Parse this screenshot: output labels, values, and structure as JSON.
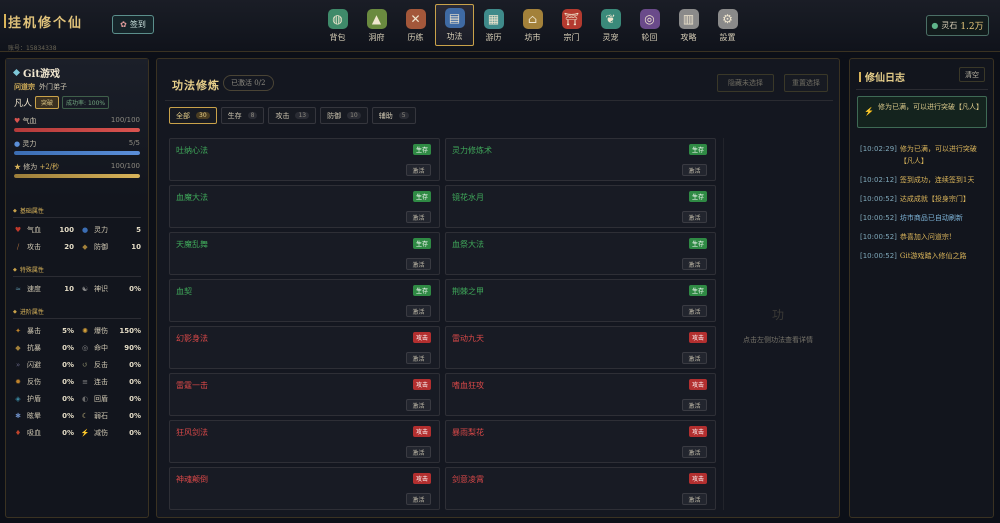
{
  "header": {
    "title": "挂机修个仙",
    "account_label": "账号：15834338",
    "checkin": "签到",
    "nav": [
      {
        "label": "背包",
        "icon": "bag-icon",
        "color": "#3f8a6a"
      },
      {
        "label": "洞府",
        "icon": "cave-icon",
        "color": "#6a8a3f"
      },
      {
        "label": "历练",
        "icon": "swords-icon",
        "color": "#a3573a"
      },
      {
        "label": "功法",
        "icon": "book-icon",
        "color": "#3f6aa3"
      },
      {
        "label": "游历",
        "icon": "map-icon",
        "color": "#3f8a8a"
      },
      {
        "label": "坊市",
        "icon": "market-icon",
        "color": "#a3813a"
      },
      {
        "label": "宗门",
        "icon": "gate-icon",
        "color": "#b33a2f"
      },
      {
        "label": "灵宠",
        "icon": "pet-icon",
        "color": "#3a8a7a"
      },
      {
        "label": "轮回",
        "icon": "cycle-icon",
        "color": "#6a4a8a"
      },
      {
        "label": "攻略",
        "icon": "guide-icon",
        "color": "#8a8a8a"
      },
      {
        "label": "設置",
        "icon": "gear-icon",
        "color": "#8a8a8a"
      }
    ],
    "currency_label": "灵石",
    "currency_value": "1.2万"
  },
  "character": {
    "name": "Git游戏",
    "sect": "问道宗",
    "rank": "外门弟子",
    "realm": "凡人",
    "breakthrough": "突破",
    "success_rate": "成功率: 100%",
    "bars": [
      {
        "label": "气血",
        "value": "100/100",
        "fill": 1.0,
        "kind": "hp"
      },
      {
        "label": "灵力",
        "value": "5/5",
        "fill": 1.0,
        "kind": "mp"
      },
      {
        "label": "修为",
        "rate": "+2/秒",
        "value": "100/100",
        "fill": 1.0,
        "kind": "xp"
      }
    ],
    "sections": [
      {
        "title": "基础属性",
        "attrs": [
          {
            "name": "气血",
            "value": "100",
            "icon": "heart-icon",
            "color": "#c0392b"
          },
          {
            "name": "灵力",
            "value": "5",
            "icon": "orb-icon",
            "color": "#3b6db3"
          },
          {
            "name": "攻击",
            "value": "20",
            "icon": "sword-icon",
            "color": "#a36a3a"
          },
          {
            "name": "防御",
            "value": "10",
            "icon": "shield-icon",
            "color": "#a3813a"
          }
        ]
      },
      {
        "title": "特殊属性",
        "attrs": [
          {
            "name": "速度",
            "value": "10",
            "icon": "wind-icon",
            "color": "#5b8fa3"
          },
          {
            "name": "神识",
            "value": "0%",
            "icon": "yinyang-icon",
            "color": "#8a8a8a"
          }
        ]
      },
      {
        "title": "进阶属性",
        "attrs": [
          {
            "name": "暴击",
            "value": "5%",
            "icon": "crit-icon",
            "color": "#c0832b"
          },
          {
            "name": "爆伤",
            "value": "150%",
            "icon": "burst-icon",
            "color": "#d9a33a"
          },
          {
            "name": "抗暴",
            "value": "0%",
            "icon": "shield-icon",
            "color": "#a3813a"
          },
          {
            "name": "命中",
            "value": "90%",
            "icon": "target-icon",
            "color": "#8a8a8a"
          },
          {
            "name": "闪避",
            "value": "0%",
            "icon": "dodge-icon",
            "color": "#6a6a8a"
          },
          {
            "name": "反击",
            "value": "0%",
            "icon": "counter-icon",
            "color": "#8a8a6a"
          },
          {
            "name": "反伤",
            "value": "0%",
            "icon": "reflect-icon",
            "color": "#c0832b"
          },
          {
            "name": "连击",
            "value": "0%",
            "icon": "combo-icon",
            "color": "#8a8a8a"
          },
          {
            "name": "护盾",
            "value": "0%",
            "icon": "barrier-icon",
            "color": "#3b8aa3"
          },
          {
            "name": "回盾",
            "value": "0%",
            "icon": "regen-icon",
            "color": "#6a6a6a"
          },
          {
            "name": "眩晕",
            "value": "0%",
            "icon": "stun-icon",
            "color": "#6a8ac0"
          },
          {
            "name": "弱石",
            "value": "0%",
            "icon": "moon-icon",
            "color": "#d9c88a"
          },
          {
            "name": "吸血",
            "value": "0%",
            "icon": "drain-icon",
            "color": "#c0432b"
          },
          {
            "name": "减伤",
            "value": "0%",
            "icon": "reduce-icon",
            "color": "#3fa85a"
          }
        ]
      }
    ]
  },
  "skills_panel": {
    "title": "功法修炼",
    "learned": "已激活 0/2",
    "hide_btn": "隐藏未选择",
    "reset_btn": "重置选择",
    "filters": [
      {
        "label": "全部",
        "count": "30",
        "active": true
      },
      {
        "label": "生存",
        "count": "8",
        "active": false
      },
      {
        "label": "攻击",
        "count": "13",
        "active": false
      },
      {
        "label": "防御",
        "count": "10",
        "active": false
      },
      {
        "label": "辅助",
        "count": "5",
        "active": false
      }
    ],
    "activate_label": "激活",
    "skills": [
      {
        "name": "吐纳心法",
        "tag": "生存",
        "kind": "def"
      },
      {
        "name": "灵力修炼术",
        "tag": "生存",
        "kind": "def"
      },
      {
        "name": "血魔大法",
        "tag": "生存",
        "kind": "def"
      },
      {
        "name": "镜花水月",
        "tag": "生存",
        "kind": "def"
      },
      {
        "name": "天魔乱舞",
        "tag": "生存",
        "kind": "def"
      },
      {
        "name": "血祭大法",
        "tag": "生存",
        "kind": "def"
      },
      {
        "name": "血契",
        "tag": "生存",
        "kind": "def"
      },
      {
        "name": "荆棘之甲",
        "tag": "生存",
        "kind": "def"
      },
      {
        "name": "幻影身法",
        "tag": "攻击",
        "kind": "atk"
      },
      {
        "name": "雷动九天",
        "tag": "攻击",
        "kind": "atk"
      },
      {
        "name": "雷霆一击",
        "tag": "攻击",
        "kind": "atk"
      },
      {
        "name": "嗜血狂攻",
        "tag": "攻击",
        "kind": "atk"
      },
      {
        "name": "狂风剑法",
        "tag": "攻击",
        "kind": "atk"
      },
      {
        "name": "暴雨梨花",
        "tag": "攻击",
        "kind": "atk"
      },
      {
        "name": "神魂颠倒",
        "tag": "攻击",
        "kind": "atk"
      },
      {
        "name": "剑意凌霄",
        "tag": "攻击",
        "kind": "atk"
      }
    ],
    "detail_icon": "功",
    "detail_hint": "点击左侧功法查看详情"
  },
  "log_panel": {
    "title": "修仙日志",
    "clear": "清空",
    "notice": "修为已满，可以进行突破【凡人】",
    "entries": [
      {
        "time": "[10:02:29]",
        "text": "修为已满，可以进行突破【凡人】",
        "color": "gold"
      },
      {
        "time": "[10:02:12]",
        "text": "签到成功，连续签到1天",
        "color": "gold"
      },
      {
        "time": "[10:00:52]",
        "text": "达成成就【投身宗门】",
        "color": "gold"
      },
      {
        "time": "[10:00:52]",
        "text": "坊市商品已自动刷新",
        "color": "blue"
      },
      {
        "time": "[10:00:52]",
        "text": "恭喜加入问道宗!",
        "color": "gold"
      },
      {
        "time": "[10:00:52]",
        "text": "Git游戏踏入修仙之路",
        "color": "gold"
      }
    ]
  }
}
